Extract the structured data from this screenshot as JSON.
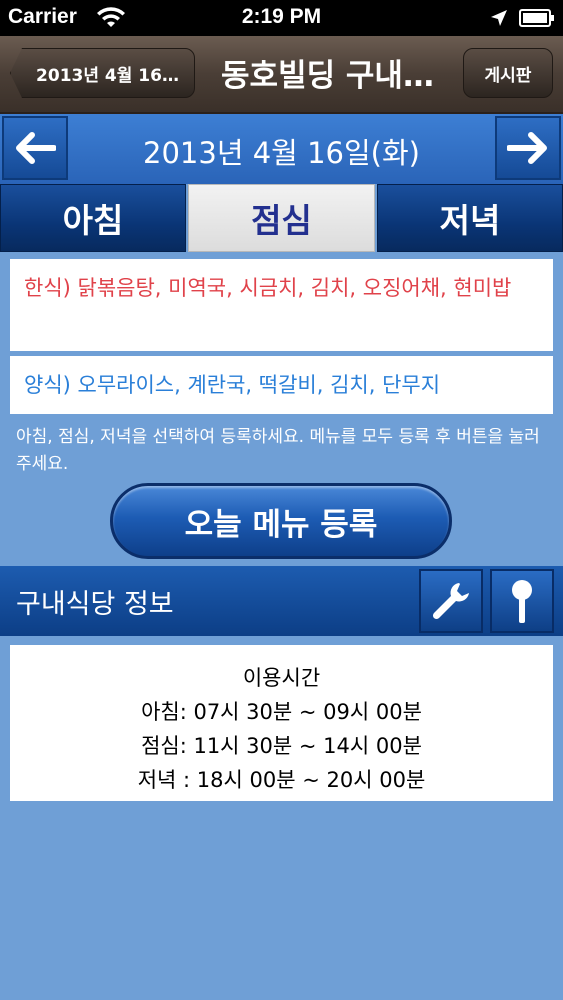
{
  "status_bar": {
    "carrier": "Carrier",
    "time": "2:19 PM"
  },
  "nav": {
    "back_label": "2013년 4월 16…",
    "title": "동호빌딩 구내…",
    "board_label": "게시판"
  },
  "date_bar": {
    "date": "2013년 4월 16일(화)",
    "prev_icon": "left-arrow-icon",
    "next_icon": "right-arrow-icon"
  },
  "tabs": [
    {
      "label": "아침",
      "active": false
    },
    {
      "label": "점심",
      "active": true
    },
    {
      "label": "저녁",
      "active": false
    }
  ],
  "menus": {
    "korean": "한식) 닭볶음탕, 미역국, 시금치, 김치, 오징어채, 현미밥",
    "western": "양식) 오무라이스, 계란국, 떡갈비, 김치, 단무지"
  },
  "instructions": "아침, 점심, 저녁을 선택하여 등록하세요.  메뉴를 모두 등록 후 버튼을 눌러주세요.",
  "register_button": "오늘 메뉴 등록",
  "info": {
    "title": "구내식당 정보",
    "settings_icon": "wrench-icon",
    "location_icon": "pin-icon"
  },
  "hours": {
    "heading": "이용시간",
    "breakfast": "아침: 07시 30분 ~ 09시 00분",
    "lunch": "점심: 11시 30분 ~ 14시 00분",
    "dinner": "저녁 : 18시 00분 ~ 20시 00분"
  },
  "colors": {
    "background": "#6f9fd6",
    "korean_menu_text": "#e0424a",
    "western_menu_text": "#2a7fd8",
    "active_tab_text": "#23308f"
  }
}
